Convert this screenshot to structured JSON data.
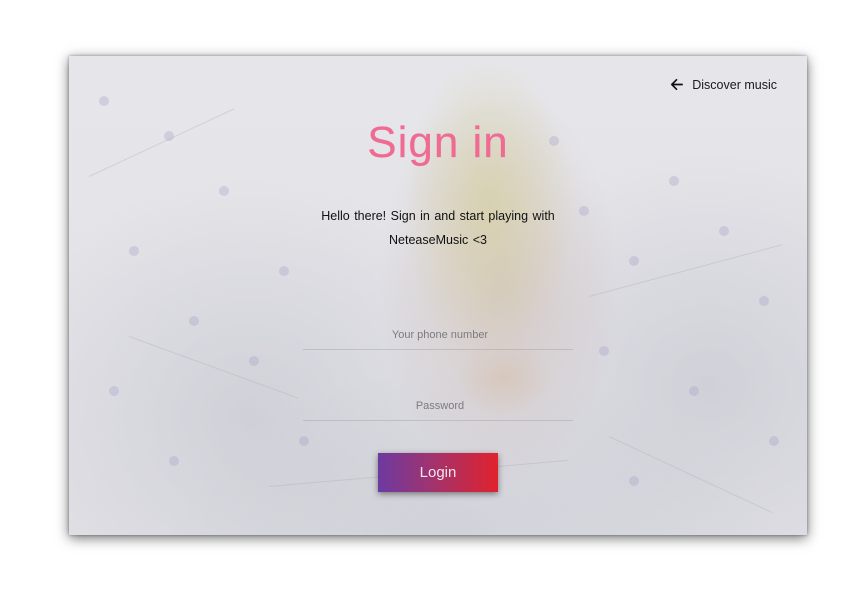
{
  "header": {
    "back_link_label": "Discover music",
    "back_icon": "arrow-left-icon"
  },
  "main": {
    "title": "Sign in",
    "subtitle_line1": "Hello there! Sign in and start playing with",
    "subtitle_line2": "NeteaseMusic <3"
  },
  "form": {
    "phone_placeholder": "Your phone number",
    "phone_value": "",
    "password_placeholder": "Password",
    "password_value": "",
    "login_label": "Login"
  },
  "colors": {
    "title": "#ef6b93",
    "button_gradient_start": "#6c3aa1",
    "button_gradient_end": "#e0222d",
    "page_background": "#ffffff"
  }
}
